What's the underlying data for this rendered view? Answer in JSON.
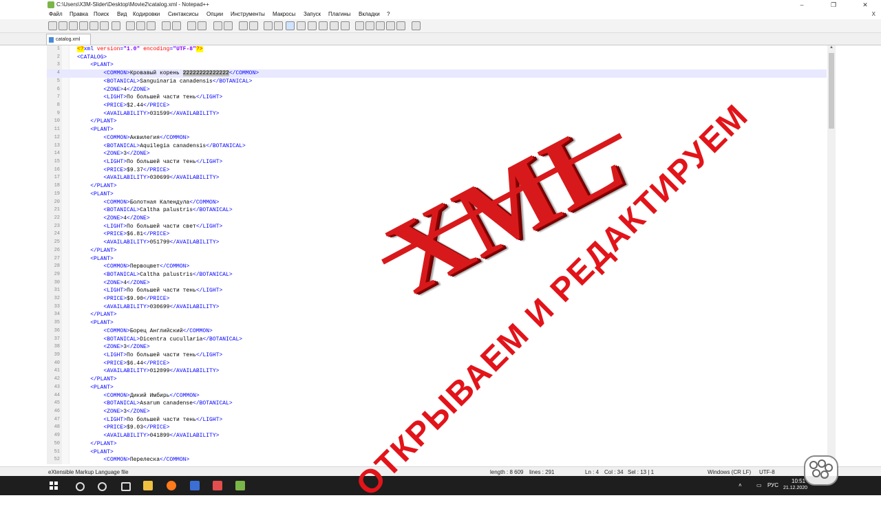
{
  "window": {
    "title": "C:\\Users\\X3M-Slider\\Desktop\\Movie2\\catalog.xml - Notepad++",
    "buttons": [
      "–",
      "❐",
      "✕"
    ]
  },
  "menu": {
    "items": [
      "Файл",
      "Правка",
      "Поиск",
      "Вид",
      "Кодировки",
      "Синтаксисы",
      "Опции",
      "Инструменты",
      "Макросы",
      "Запуск",
      "Плагины",
      "Вкладки",
      "?"
    ],
    "close_label": "X"
  },
  "tab": {
    "label": "catalog.xml"
  },
  "editor": {
    "lines": [
      {
        "n": "1",
        "segs": [
          [
            "pi",
            "<?"
          ],
          [
            "t",
            "xml "
          ],
          [
            "a",
            "version"
          ],
          [
            "t",
            "="
          ],
          [
            "v",
            "\"1.0\""
          ],
          [
            "t",
            " "
          ],
          [
            "a",
            "encoding"
          ],
          [
            "t",
            "="
          ],
          [
            "v",
            "\"UTF-8\""
          ],
          [
            "pi",
            "?>"
          ]
        ]
      },
      {
        "n": "2",
        "segs": [
          [
            "t",
            "<CATALOG>"
          ]
        ]
      },
      {
        "n": "3",
        "segs": [
          [
            "x",
            "    "
          ],
          [
            "t",
            "<PLANT>"
          ]
        ]
      },
      {
        "n": "4",
        "cur": true,
        "segs": [
          [
            "x",
            "        "
          ],
          [
            "t",
            "<COMMON>"
          ],
          [
            "x",
            "Кровавый корень "
          ],
          [
            "sel",
            "22222222222222"
          ],
          [
            "t",
            "</COMMON>"
          ]
        ]
      },
      {
        "n": "5",
        "segs": [
          [
            "x",
            "        "
          ],
          [
            "t",
            "<BOTANICAL>"
          ],
          [
            "x",
            "Sanguinaria canadensis"
          ],
          [
            "t",
            "</BOTANICAL>"
          ]
        ]
      },
      {
        "n": "6",
        "segs": [
          [
            "x",
            "        "
          ],
          [
            "t",
            "<ZONE>"
          ],
          [
            "x",
            "4"
          ],
          [
            "t",
            "</ZONE>"
          ]
        ]
      },
      {
        "n": "7",
        "segs": [
          [
            "x",
            "        "
          ],
          [
            "t",
            "<LIGHT>"
          ],
          [
            "x",
            "По большей части тень"
          ],
          [
            "t",
            "</LIGHT>"
          ]
        ]
      },
      {
        "n": "8",
        "segs": [
          [
            "x",
            "        "
          ],
          [
            "t",
            "<PRICE>"
          ],
          [
            "x",
            "$2.44"
          ],
          [
            "t",
            "</PRICE>"
          ]
        ]
      },
      {
        "n": "9",
        "segs": [
          [
            "x",
            "        "
          ],
          [
            "t",
            "<AVAILABILITY>"
          ],
          [
            "x",
            "031599"
          ],
          [
            "t",
            "</AVAILABILITY>"
          ]
        ]
      },
      {
        "n": "10",
        "segs": [
          [
            "x",
            "    "
          ],
          [
            "t",
            "</PLANT>"
          ]
        ]
      },
      {
        "n": "11",
        "segs": [
          [
            "x",
            "    "
          ],
          [
            "t",
            "<PLANT>"
          ]
        ]
      },
      {
        "n": "12",
        "segs": [
          [
            "x",
            "        "
          ],
          [
            "t",
            "<COMMON>"
          ],
          [
            "x",
            "Аквилегия"
          ],
          [
            "t",
            "</COMMON>"
          ]
        ]
      },
      {
        "n": "13",
        "segs": [
          [
            "x",
            "        "
          ],
          [
            "t",
            "<BOTANICAL>"
          ],
          [
            "x",
            "Aquilegia canadensis"
          ],
          [
            "t",
            "</BOTANICAL>"
          ]
        ]
      },
      {
        "n": "14",
        "segs": [
          [
            "x",
            "        "
          ],
          [
            "t",
            "<ZONE>"
          ],
          [
            "x",
            "3"
          ],
          [
            "t",
            "</ZONE>"
          ]
        ]
      },
      {
        "n": "15",
        "segs": [
          [
            "x",
            "        "
          ],
          [
            "t",
            "<LIGHT>"
          ],
          [
            "x",
            "По большей части тень"
          ],
          [
            "t",
            "</LIGHT>"
          ]
        ]
      },
      {
        "n": "16",
        "segs": [
          [
            "x",
            "        "
          ],
          [
            "t",
            "<PRICE>"
          ],
          [
            "x",
            "$9.37"
          ],
          [
            "t",
            "</PRICE>"
          ]
        ]
      },
      {
        "n": "17",
        "segs": [
          [
            "x",
            "        "
          ],
          [
            "t",
            "<AVAILABILITY>"
          ],
          [
            "x",
            "030699"
          ],
          [
            "t",
            "</AVAILABILITY>"
          ]
        ]
      },
      {
        "n": "18",
        "segs": [
          [
            "x",
            "    "
          ],
          [
            "t",
            "</PLANT>"
          ]
        ]
      },
      {
        "n": "19",
        "segs": [
          [
            "x",
            "    "
          ],
          [
            "t",
            "<PLANT>"
          ]
        ]
      },
      {
        "n": "20",
        "segs": [
          [
            "x",
            "        "
          ],
          [
            "t",
            "<COMMON>"
          ],
          [
            "x",
            "Болотная Календула"
          ],
          [
            "t",
            "</COMMON>"
          ]
        ]
      },
      {
        "n": "21",
        "segs": [
          [
            "x",
            "        "
          ],
          [
            "t",
            "<BOTANICAL>"
          ],
          [
            "x",
            "Caltha palustris"
          ],
          [
            "t",
            "</BOTANICAL>"
          ]
        ]
      },
      {
        "n": "22",
        "segs": [
          [
            "x",
            "        "
          ],
          [
            "t",
            "<ZONE>"
          ],
          [
            "x",
            "4"
          ],
          [
            "t",
            "</ZONE>"
          ]
        ]
      },
      {
        "n": "23",
        "segs": [
          [
            "x",
            "        "
          ],
          [
            "t",
            "<LIGHT>"
          ],
          [
            "x",
            "По большей части свет"
          ],
          [
            "t",
            "</LIGHT>"
          ]
        ]
      },
      {
        "n": "24",
        "segs": [
          [
            "x",
            "        "
          ],
          [
            "t",
            "<PRICE>"
          ],
          [
            "x",
            "$6.81"
          ],
          [
            "t",
            "</PRICE>"
          ]
        ]
      },
      {
        "n": "25",
        "segs": [
          [
            "x",
            "        "
          ],
          [
            "t",
            "<AVAILABILITY>"
          ],
          [
            "x",
            "051799"
          ],
          [
            "t",
            "</AVAILABILITY>"
          ]
        ]
      },
      {
        "n": "26",
        "segs": [
          [
            "x",
            "    "
          ],
          [
            "t",
            "</PLANT>"
          ]
        ]
      },
      {
        "n": "27",
        "segs": [
          [
            "x",
            "    "
          ],
          [
            "t",
            "<PLANT>"
          ]
        ]
      },
      {
        "n": "28",
        "segs": [
          [
            "x",
            "        "
          ],
          [
            "t",
            "<COMMON>"
          ],
          [
            "x",
            "Первоцвет"
          ],
          [
            "t",
            "</COMMON>"
          ]
        ]
      },
      {
        "n": "29",
        "segs": [
          [
            "x",
            "        "
          ],
          [
            "t",
            "<BOTANICAL>"
          ],
          [
            "x",
            "Caltha palustris"
          ],
          [
            "t",
            "</BOTANICAL>"
          ]
        ]
      },
      {
        "n": "30",
        "segs": [
          [
            "x",
            "        "
          ],
          [
            "t",
            "<ZONE>"
          ],
          [
            "x",
            "4"
          ],
          [
            "t",
            "</ZONE>"
          ]
        ]
      },
      {
        "n": "31",
        "segs": [
          [
            "x",
            "        "
          ],
          [
            "t",
            "<LIGHT>"
          ],
          [
            "x",
            "По большей части тень"
          ],
          [
            "t",
            "</LIGHT>"
          ]
        ]
      },
      {
        "n": "32",
        "segs": [
          [
            "x",
            "        "
          ],
          [
            "t",
            "<PRICE>"
          ],
          [
            "x",
            "$9.90"
          ],
          [
            "t",
            "</PRICE>"
          ]
        ]
      },
      {
        "n": "33",
        "segs": [
          [
            "x",
            "        "
          ],
          [
            "t",
            "<AVAILABILITY>"
          ],
          [
            "x",
            "030699"
          ],
          [
            "t",
            "</AVAILABILITY>"
          ]
        ]
      },
      {
        "n": "34",
        "segs": [
          [
            "x",
            "    "
          ],
          [
            "t",
            "</PLANT>"
          ]
        ]
      },
      {
        "n": "35",
        "segs": [
          [
            "x",
            "    "
          ],
          [
            "t",
            "<PLANT>"
          ]
        ]
      },
      {
        "n": "36",
        "segs": [
          [
            "x",
            "        "
          ],
          [
            "t",
            "<COMMON>"
          ],
          [
            "x",
            "Борец Английский"
          ],
          [
            "t",
            "</COMMON>"
          ]
        ]
      },
      {
        "n": "37",
        "segs": [
          [
            "x",
            "        "
          ],
          [
            "t",
            "<BOTANICAL>"
          ],
          [
            "x",
            "Dicentra cucullaria"
          ],
          [
            "t",
            "</BOTANICAL>"
          ]
        ]
      },
      {
        "n": "38",
        "segs": [
          [
            "x",
            "        "
          ],
          [
            "t",
            "<ZONE>"
          ],
          [
            "x",
            "3"
          ],
          [
            "t",
            "</ZONE>"
          ]
        ]
      },
      {
        "n": "39",
        "segs": [
          [
            "x",
            "        "
          ],
          [
            "t",
            "<LIGHT>"
          ],
          [
            "x",
            "По большей части тень"
          ],
          [
            "t",
            "</LIGHT>"
          ]
        ]
      },
      {
        "n": "40",
        "segs": [
          [
            "x",
            "        "
          ],
          [
            "t",
            "<PRICE>"
          ],
          [
            "x",
            "$6.44"
          ],
          [
            "t",
            "</PRICE>"
          ]
        ]
      },
      {
        "n": "41",
        "segs": [
          [
            "x",
            "        "
          ],
          [
            "t",
            "<AVAILABILITY>"
          ],
          [
            "x",
            "012099"
          ],
          [
            "t",
            "</AVAILABILITY>"
          ]
        ]
      },
      {
        "n": "42",
        "segs": [
          [
            "x",
            "    "
          ],
          [
            "t",
            "</PLANT>"
          ]
        ]
      },
      {
        "n": "43",
        "segs": [
          [
            "x",
            "    "
          ],
          [
            "t",
            "<PLANT>"
          ]
        ]
      },
      {
        "n": "44",
        "segs": [
          [
            "x",
            "        "
          ],
          [
            "t",
            "<COMMON>"
          ],
          [
            "x",
            "Дикий Имбирь"
          ],
          [
            "t",
            "</COMMON>"
          ]
        ]
      },
      {
        "n": "45",
        "segs": [
          [
            "x",
            "        "
          ],
          [
            "t",
            "<BOTANICAL>"
          ],
          [
            "x",
            "Asarum canadense"
          ],
          [
            "t",
            "</BOTANICAL>"
          ]
        ]
      },
      {
        "n": "46",
        "segs": [
          [
            "x",
            "        "
          ],
          [
            "t",
            "<ZONE>"
          ],
          [
            "x",
            "3"
          ],
          [
            "t",
            "</ZONE>"
          ]
        ]
      },
      {
        "n": "47",
        "segs": [
          [
            "x",
            "        "
          ],
          [
            "t",
            "<LIGHT>"
          ],
          [
            "x",
            "По большей части тень"
          ],
          [
            "t",
            "</LIGHT>"
          ]
        ]
      },
      {
        "n": "48",
        "segs": [
          [
            "x",
            "        "
          ],
          [
            "t",
            "<PRICE>"
          ],
          [
            "x",
            "$9.03"
          ],
          [
            "t",
            "</PRICE>"
          ]
        ]
      },
      {
        "n": "49",
        "segs": [
          [
            "x",
            "        "
          ],
          [
            "t",
            "<AVAILABILITY>"
          ],
          [
            "x",
            "041899"
          ],
          [
            "t",
            "</AVAILABILITY>"
          ]
        ]
      },
      {
        "n": "50",
        "segs": [
          [
            "x",
            "    "
          ],
          [
            "t",
            "</PLANT>"
          ]
        ]
      },
      {
        "n": "51",
        "segs": [
          [
            "x",
            "    "
          ],
          [
            "t",
            "<PLANT>"
          ]
        ]
      },
      {
        "n": "52",
        "segs": [
          [
            "x",
            "        "
          ],
          [
            "t",
            "<COMMON>"
          ],
          [
            "x",
            "Перелеска"
          ],
          [
            "t",
            "</COMMON>"
          ]
        ]
      }
    ]
  },
  "status": {
    "filetype": "eXtensible Markup Language file",
    "length": "length : 8 609",
    "lines": "lines : 291",
    "ln": "Ln : 4",
    "col": "Col : 34",
    "sel": "Sel : 13 | 1",
    "eol": "Windows (CR LF)",
    "encoding": "UTF-8"
  },
  "overlay": {
    "title": "XML",
    "subtitle": "ОТКРЫВАЕМ И РЕДАКТИРУЕМ"
  },
  "taskbar": {
    "lang": "РУС",
    "time": "10:51",
    "date": "21.12.2020"
  },
  "colors": {
    "tag": "#0000ff",
    "attr": "#ff0000",
    "value": "#8000ff",
    "overlay_red": "#d8191b"
  }
}
